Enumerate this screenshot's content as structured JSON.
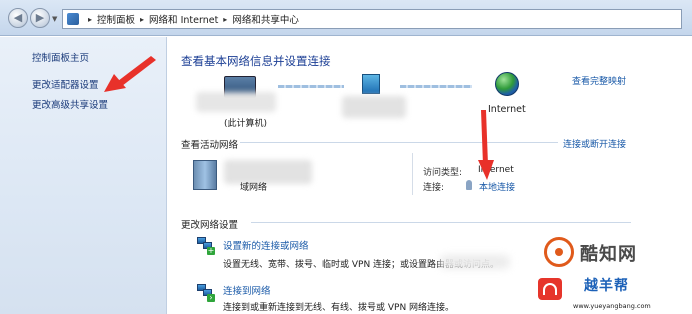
{
  "address_bar": {
    "crumbs": [
      "控制面板",
      "网络和 Internet",
      "网络和共享中心"
    ]
  },
  "left_nav": {
    "items": [
      {
        "label": "控制面板主页"
      },
      {
        "label": "更改适配器设置"
      },
      {
        "label": "更改高级共享设置"
      }
    ]
  },
  "main": {
    "title": "查看基本网络信息并设置连接",
    "see_full_map": "查看完整映射",
    "map": {
      "computer_label": "(此计算机)",
      "internet_label": "Internet"
    },
    "active_networks": {
      "heading": "查看活动网络",
      "connect_disconnect": "连接或断开连接",
      "network_name_suffix": "域网络",
      "access_type_label": "访问类型:",
      "access_type_value": "Internet",
      "connections_label": "连接:",
      "connection_link": "本地连接"
    },
    "change_settings": {
      "heading": "更改网络设置",
      "tasks": [
        {
          "title": "设置新的连接或网络",
          "desc": "设置无线、宽带、拨号、临时或 VPN 连接；或设置路由器或访问点。"
        },
        {
          "title": "连接到网络",
          "desc": "连接到或重新连接到无线、有线、拨号或 VPN 网络连接。"
        }
      ]
    }
  },
  "watermark": {
    "name": "酷知网",
    "tag": "越羊帮",
    "url": "www.yueyangbang.com"
  },
  "colors": {
    "link": "#1a5aa8",
    "title": "#1c3f95",
    "annotation_arrow": "#e8312a",
    "nav_bg": "#dce7f4"
  }
}
